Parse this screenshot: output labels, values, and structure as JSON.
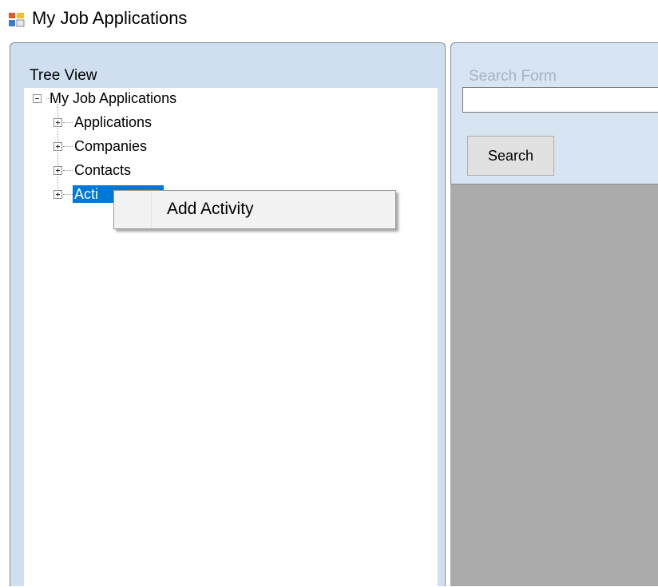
{
  "window": {
    "title": "My Job Applications",
    "icon": "windows-forms-app-icon"
  },
  "tree_panel": {
    "title": "Tree View",
    "root": {
      "label": "My Job Applications",
      "expanded": true,
      "children": [
        {
          "label": "Applications",
          "expanded": false
        },
        {
          "label": "Companies",
          "expanded": false
        },
        {
          "label": "Contacts",
          "expanded": false
        },
        {
          "label": "Acti",
          "expanded": false,
          "selected": true
        }
      ]
    }
  },
  "search_panel": {
    "title": "Search Form",
    "input_value": "",
    "button_label": "Search"
  },
  "context_menu": {
    "items": [
      {
        "label": "Add Activity"
      }
    ]
  },
  "colors": {
    "selection": "#0078d7",
    "panel_header": "#cfdff0",
    "mdi_background": "#ababab"
  }
}
